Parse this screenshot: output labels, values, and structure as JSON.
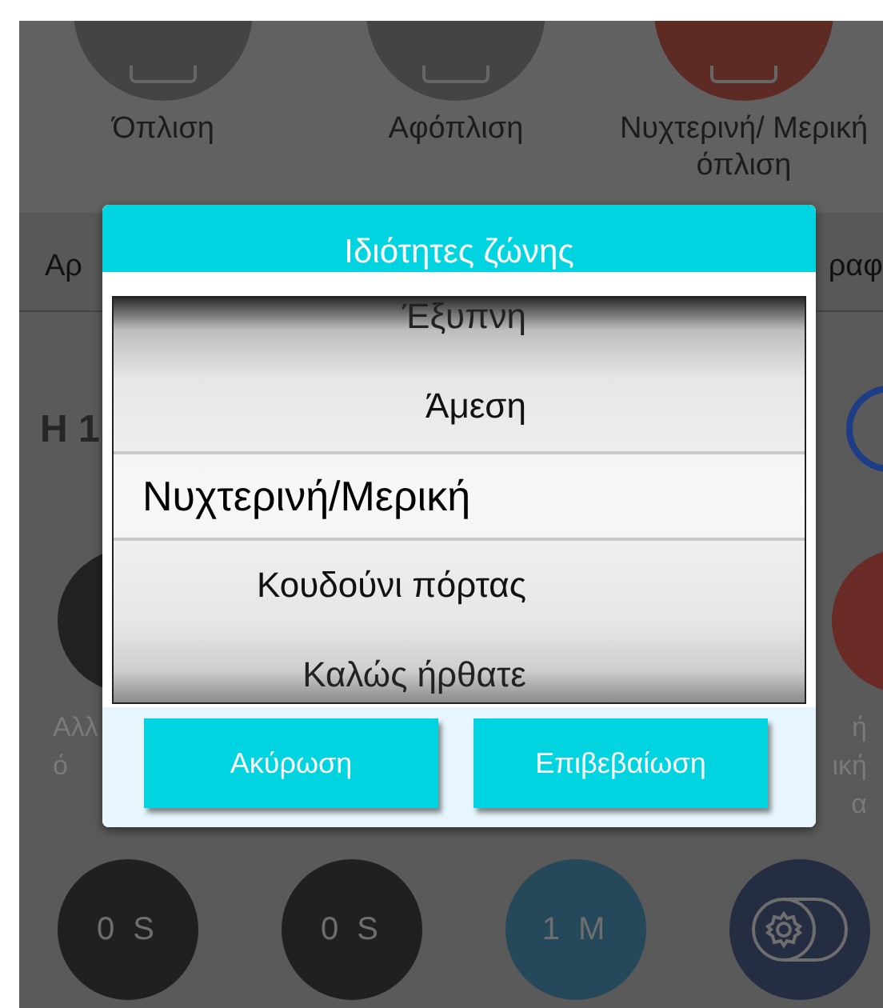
{
  "top_actions": [
    {
      "label": "Όπλιση",
      "color": "#444444"
    },
    {
      "label": "Αφόπλιση",
      "color": "#444444"
    },
    {
      "label": "Νυχτερινή/ Μερική όπλιση",
      "color": "#5e2a24"
    }
  ],
  "tab_strip": {
    "column_1": "Αρ",
    "column_2": "ραφ"
  },
  "zone_heading": "Η 1",
  "partial_labels_left": [
    "Αλλ",
    "ό"
  ],
  "partial_labels_right": [
    "ή",
    "ική",
    "α"
  ],
  "timers": [
    {
      "kind": "text",
      "label": "0 S",
      "color": "#202020"
    },
    {
      "kind": "text",
      "label": "0 S",
      "color": "#202020"
    },
    {
      "kind": "text",
      "label": "1 M",
      "color": "#25485a"
    },
    {
      "kind": "icon",
      "color": "#252d42"
    }
  ],
  "dialog": {
    "title": "Ιδιότητες ζώνης",
    "options": [
      {
        "label": "Έξυπνη",
        "selected": false
      },
      {
        "label": "Άμεση",
        "selected": false
      },
      {
        "label": "Νυχτερινή/Μερική",
        "selected": true
      },
      {
        "label": "Κουδούνι πόρτας",
        "selected": false
      },
      {
        "label": "Καλώς ήρθατε",
        "selected": false
      }
    ],
    "buttons": [
      "Ακύρωση",
      "Επιβεβαίωση"
    ]
  }
}
